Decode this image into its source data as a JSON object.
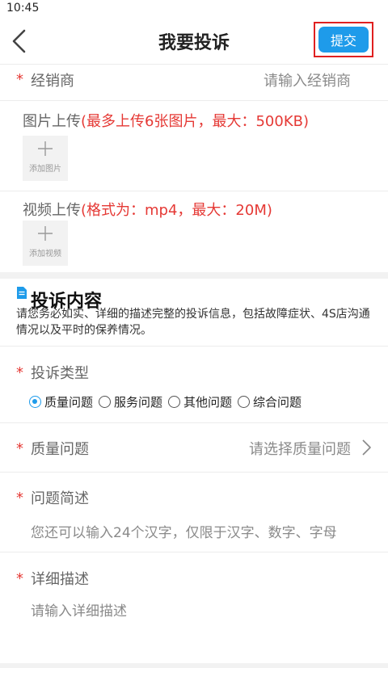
{
  "status": {
    "time": "10:45"
  },
  "nav": {
    "title": "我要投诉",
    "submit_label": "提交"
  },
  "dealer": {
    "required_mark": "*",
    "label": "经销商",
    "placeholder": "请输入经销商"
  },
  "image_upload": {
    "label": "图片上传",
    "hint": "(最多上传6张图片，最大：500KB)",
    "add_label": "添加图片"
  },
  "video_upload": {
    "label": "视频上传",
    "hint": "(格式为：mp4，最大：20M)",
    "add_label": "添加视频"
  },
  "complaint_section": {
    "title": "投诉内容",
    "description": "请您务必如实、详细的描述完整的投诉信息，包括故障症状、4S店沟通情况以及平时的保养情况。"
  },
  "complaint_type": {
    "required_mark": "*",
    "label": "投诉类型",
    "options": [
      {
        "label": "质量问题",
        "checked": true
      },
      {
        "label": "服务问题",
        "checked": false
      },
      {
        "label": "其他问题",
        "checked": false
      },
      {
        "label": "综合问题",
        "checked": false
      }
    ]
  },
  "quality_issue": {
    "required_mark": "*",
    "label": "质量问题",
    "placeholder": "请选择质量问题"
  },
  "summary": {
    "required_mark": "*",
    "label": "问题简述",
    "placeholder": "您还可以输入24个汉字，仅限于汉字、数字、字母"
  },
  "detail": {
    "required_mark": "*",
    "label": "详细描述",
    "placeholder": "请输入详细描述"
  },
  "colors": {
    "accent": "#1e9bea",
    "required": "#e53935",
    "highlight_border": "#e02020"
  }
}
